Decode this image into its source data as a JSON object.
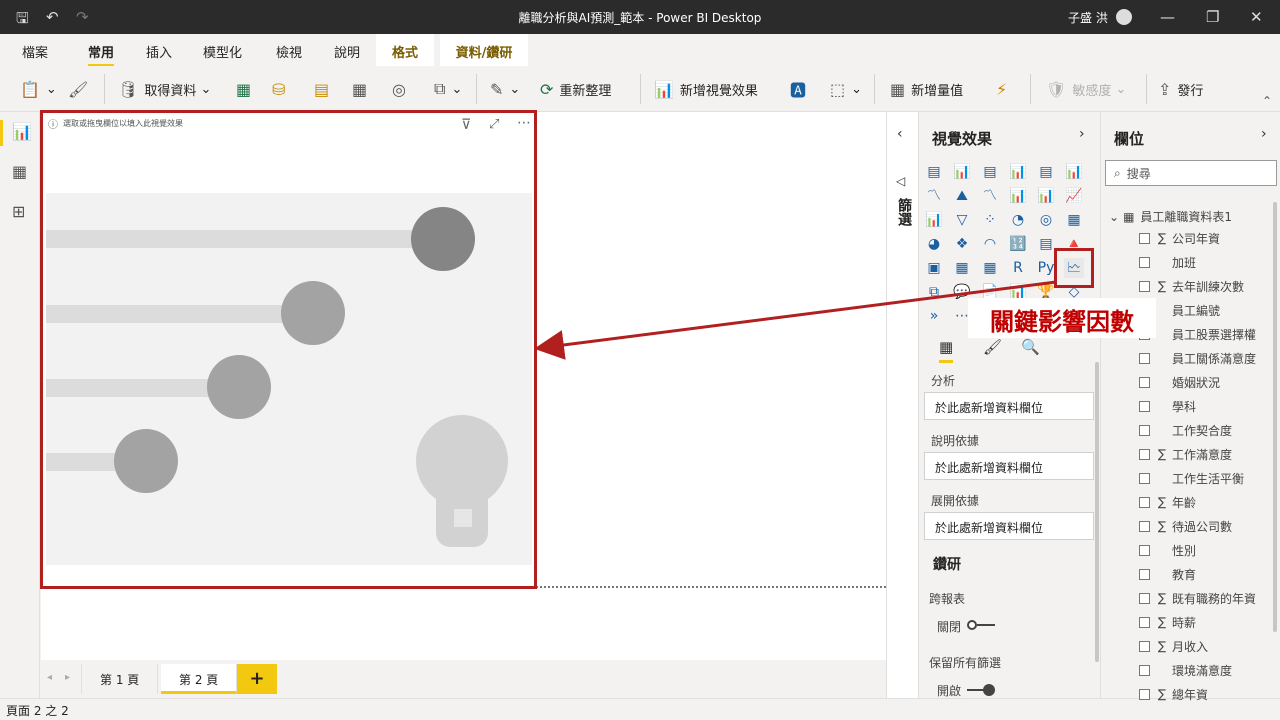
{
  "title": "離職分析與AI預測_範本 - Power BI Desktop",
  "user": "子盛 洪",
  "menu": [
    "檔案",
    "常用",
    "插入",
    "模型化",
    "檢視",
    "說明",
    "格式",
    "資料/鑽研"
  ],
  "ribbon": {
    "get_data": "取得資料",
    "refresh": "重新整理",
    "new_visual": "新增視覺效果",
    "new_measure": "新增量值",
    "sensitivity": "敏感度",
    "publish": "發行"
  },
  "visual": {
    "hint": "選取或拖曳欄位以填入此視覺效果"
  },
  "pages": [
    "第 1 頁",
    "第 2 頁"
  ],
  "add_page": "+",
  "status": "頁面 2 之 2",
  "filters_label": "篩選",
  "viz_panel": {
    "title": "視覺效果",
    "wells": [
      {
        "label": "分析",
        "placeholder": "於此處新增資料欄位"
      },
      {
        "label": "說明依據",
        "placeholder": "於此處新增資料欄位"
      },
      {
        "label": "展開依據",
        "placeholder": "於此處新增資料欄位"
      }
    ],
    "drill": "鑽研",
    "cross_report": "跨報表",
    "cross_report_state": "關閉",
    "keep_filters": "保留所有篩選",
    "keep_filters_state": "開啟"
  },
  "annotation": "關鍵影響因數",
  "fields_panel": {
    "title": "欄位",
    "search_placeholder": "搜尋",
    "table": "員工離職資料表1",
    "fields": [
      {
        "name": "公司年資",
        "sum": true
      },
      {
        "name": "加班",
        "sum": false
      },
      {
        "name": "去年訓練次數",
        "sum": true
      },
      {
        "name": "員工編號",
        "sum": false
      },
      {
        "name": "員工股票選擇權",
        "sum": false
      },
      {
        "name": "員工關係滿意度",
        "sum": false
      },
      {
        "name": "婚姻狀況",
        "sum": false
      },
      {
        "name": "學科",
        "sum": false
      },
      {
        "name": "工作契合度",
        "sum": false
      },
      {
        "name": "工作滿意度",
        "sum": true
      },
      {
        "name": "工作生活平衡",
        "sum": false
      },
      {
        "name": "年齡",
        "sum": true
      },
      {
        "name": "待過公司數",
        "sum": true
      },
      {
        "name": "性別",
        "sum": false
      },
      {
        "name": "教育",
        "sum": false
      },
      {
        "name": "既有職務的年資",
        "sum": true
      },
      {
        "name": "時薪",
        "sum": true
      },
      {
        "name": "月收入",
        "sum": true
      },
      {
        "name": "環境滿意度",
        "sum": false
      },
      {
        "name": "總年資",
        "sum": true
      }
    ]
  },
  "colors": {
    "accent": "#f2c811",
    "highlight": "#b21f1f",
    "annotation_text": "#c00000"
  }
}
